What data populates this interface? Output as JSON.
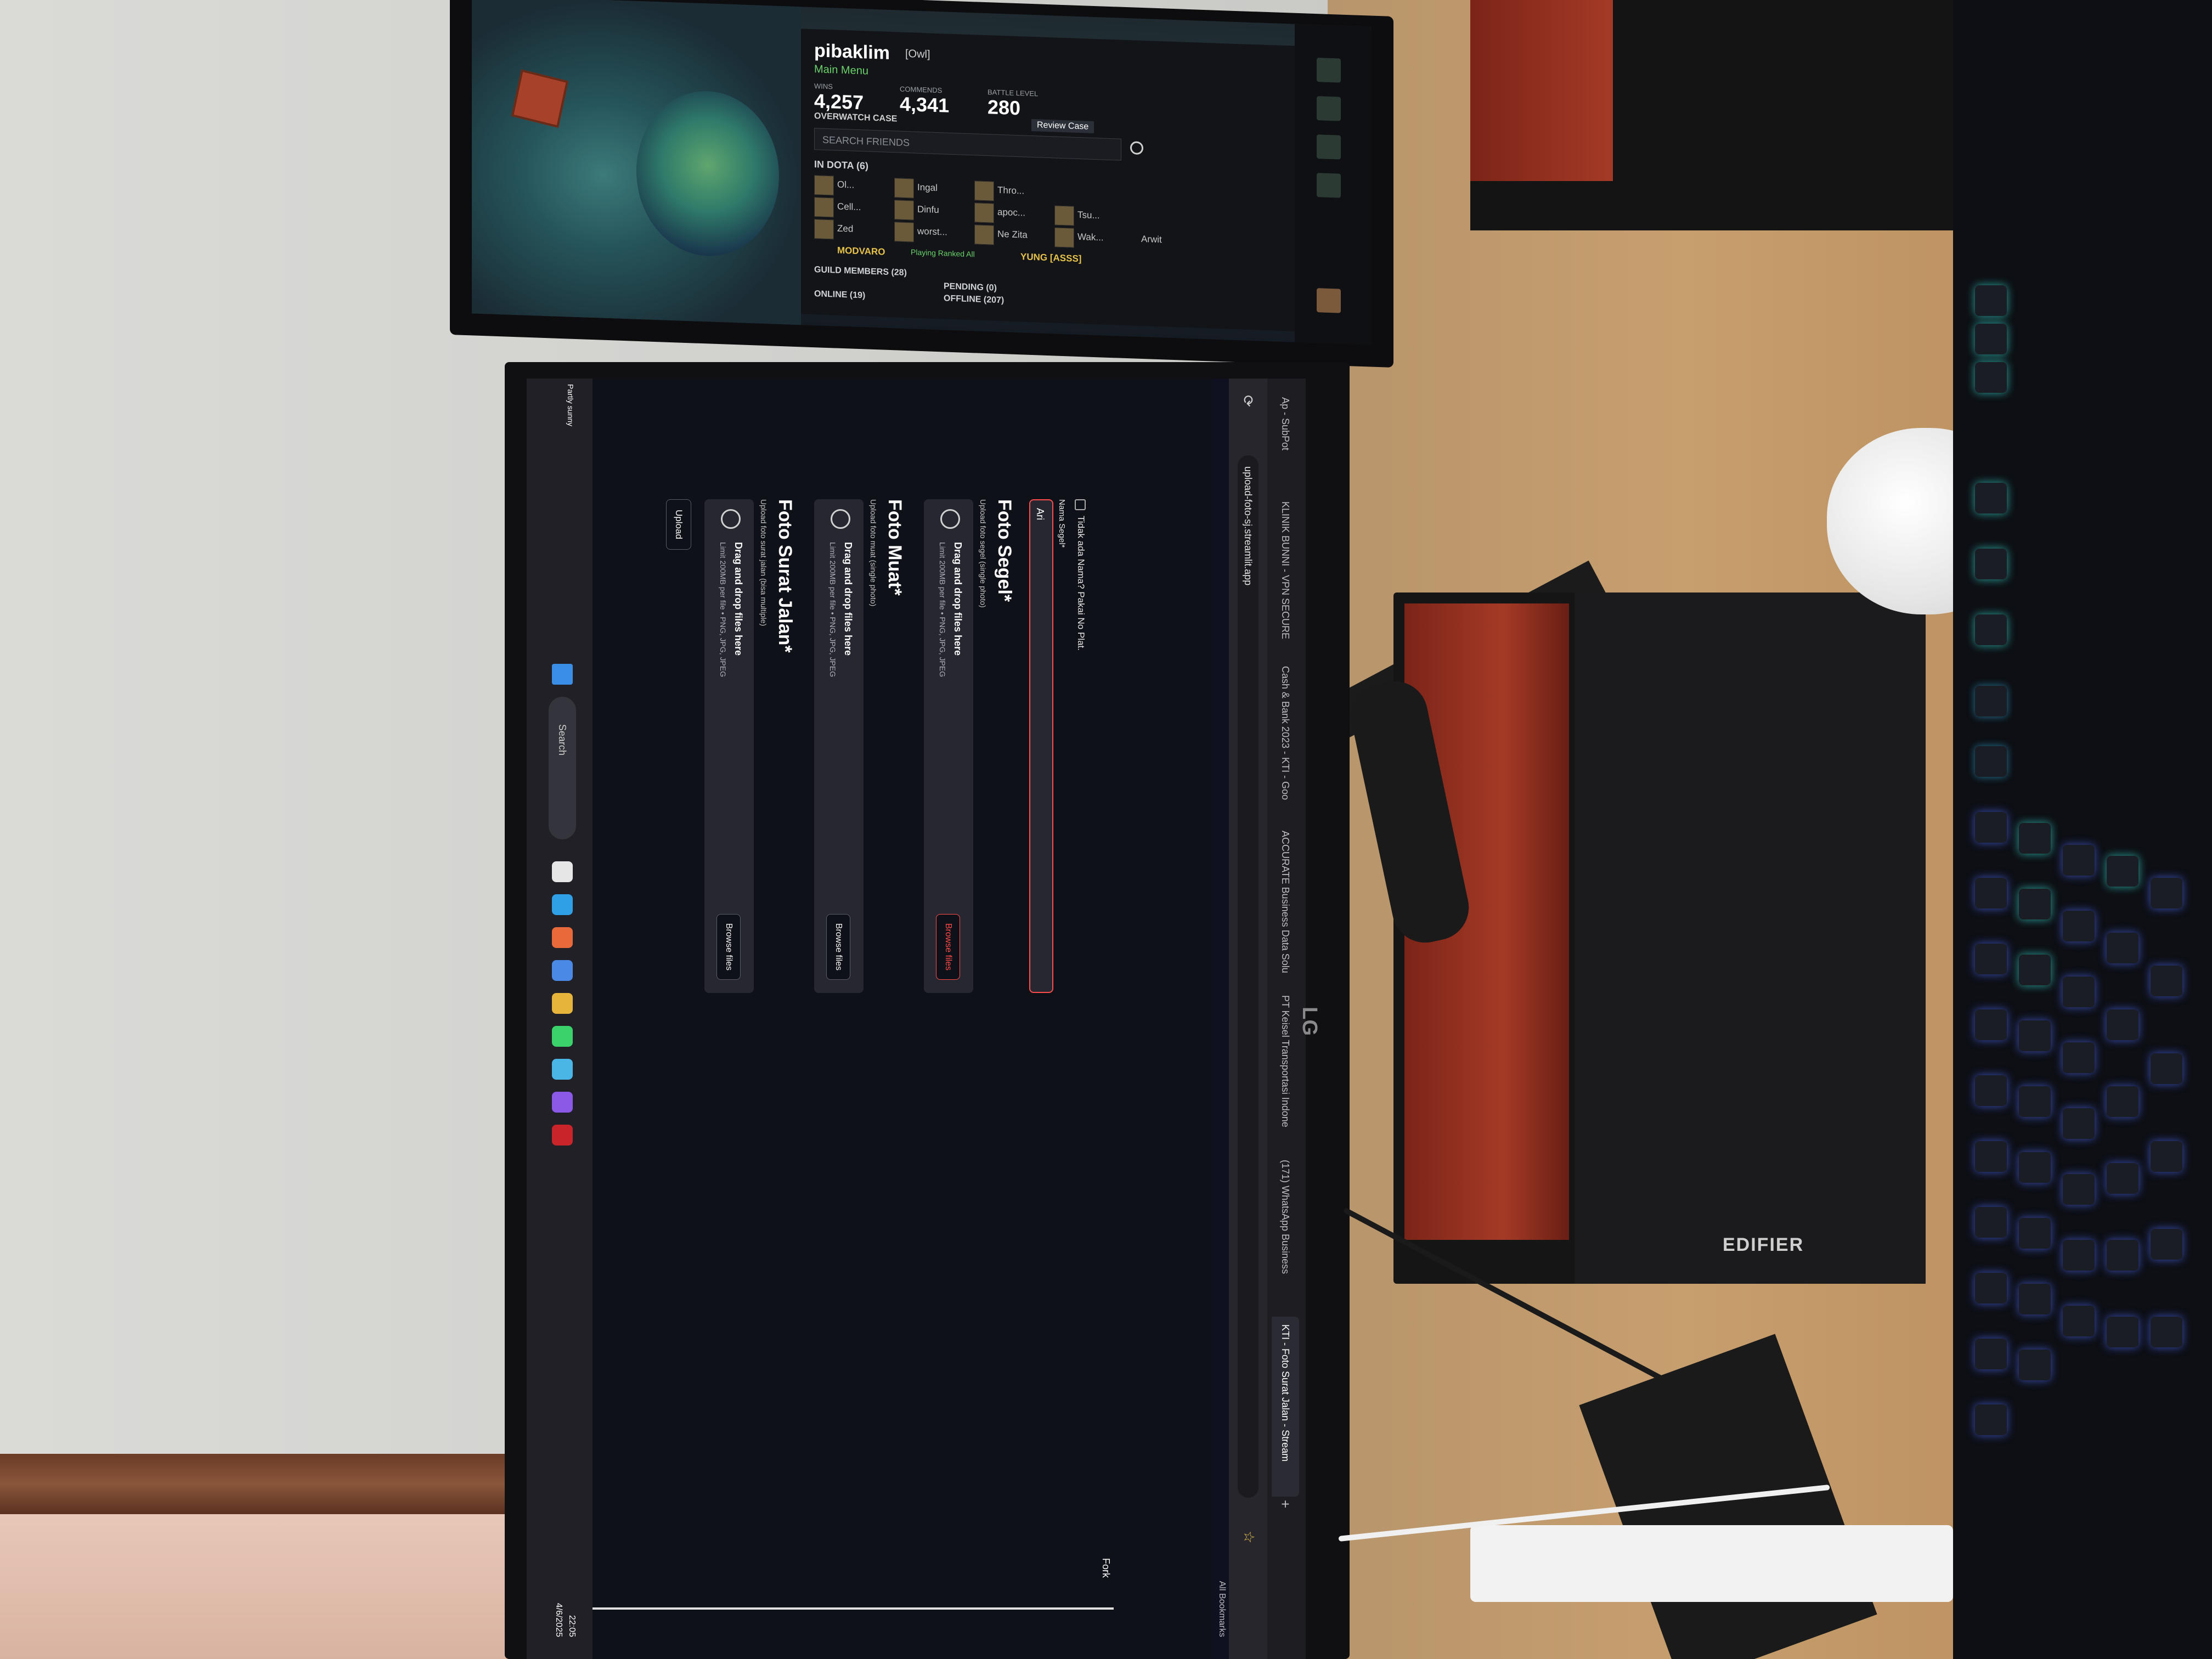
{
  "dota": {
    "profile_name": "pibaklim",
    "profile_tag": "[Owl]",
    "profile_status": "Main Menu",
    "stat_wins_label": "WINS",
    "stat_wins": "4,257",
    "stat_commends_label": "COMMENDS",
    "stat_commends": "4,341",
    "stat_level_label": "BATTLE LEVEL",
    "stat_level": "280",
    "overwatch": "OVERWATCH CASE",
    "review_case": "Review Case",
    "search_friends": "SEARCH FRIENDS",
    "in_dota": "IN DOTA (6)",
    "friends": [
      "Ol...",
      "Ingal",
      "Thro...",
      "Cell...",
      "Dinfu",
      "apoc...",
      "Tsu...",
      "Zed",
      "worst...",
      "Ne Zita",
      "Wak...",
      "Arwit"
    ],
    "modvaro": "MODVARO",
    "modvaro_status": "Playing Ranked All",
    "yung": "YUNG [ASSS]",
    "guild_members": "GUILD MEMBERS (28)",
    "pending": "PENDING (0)",
    "online": "ONLINE (19)",
    "offline": "OFFLINE (207)"
  },
  "browser": {
    "tabs": [
      "Ap - SubPot",
      "KLINIK BUNNI - VPN SECURE",
      "Cash & Bank 2023 - KTI - Goo",
      "ACCURATE Business Data Solu",
      "PT Keisel Transportasi Indone",
      "(171) WhatsApp Business",
      "KTI - Foto Surat Jalan - Stream"
    ],
    "url": "upload-foto-sj.streamlit.app",
    "all_bookmarks": "All Bookmarks",
    "fork": "Fork"
  },
  "form": {
    "checkbox_label": "Tidak ada Nama? Pakai No Plat.",
    "name_label": "Nama Segel*",
    "name_value": "Ari",
    "sections": [
      {
        "title": "Foto Segel*",
        "help": "Upload foto segel (single photo)",
        "hot": true
      },
      {
        "title": "Foto Muat*",
        "help": "Upload foto muat (single photo)",
        "hot": false
      },
      {
        "title": "Foto Surat Jalan*",
        "help": "Upload foto surat jalan (bisa multiple)",
        "hot": false
      }
    ],
    "dropzone_title": "Drag and drop files here",
    "dropzone_limit": "Limit 200MB per file • PNG, JPG, JPEG",
    "browse_label": "Browse files",
    "upload_label": "Upload"
  },
  "taskbar": {
    "search": "Search",
    "time": "22:05",
    "date": "4/6/2025",
    "weather": "Partly sunny"
  },
  "desk": {
    "speaker_brand": "EDIFIER",
    "monitor_brand": "LG"
  }
}
